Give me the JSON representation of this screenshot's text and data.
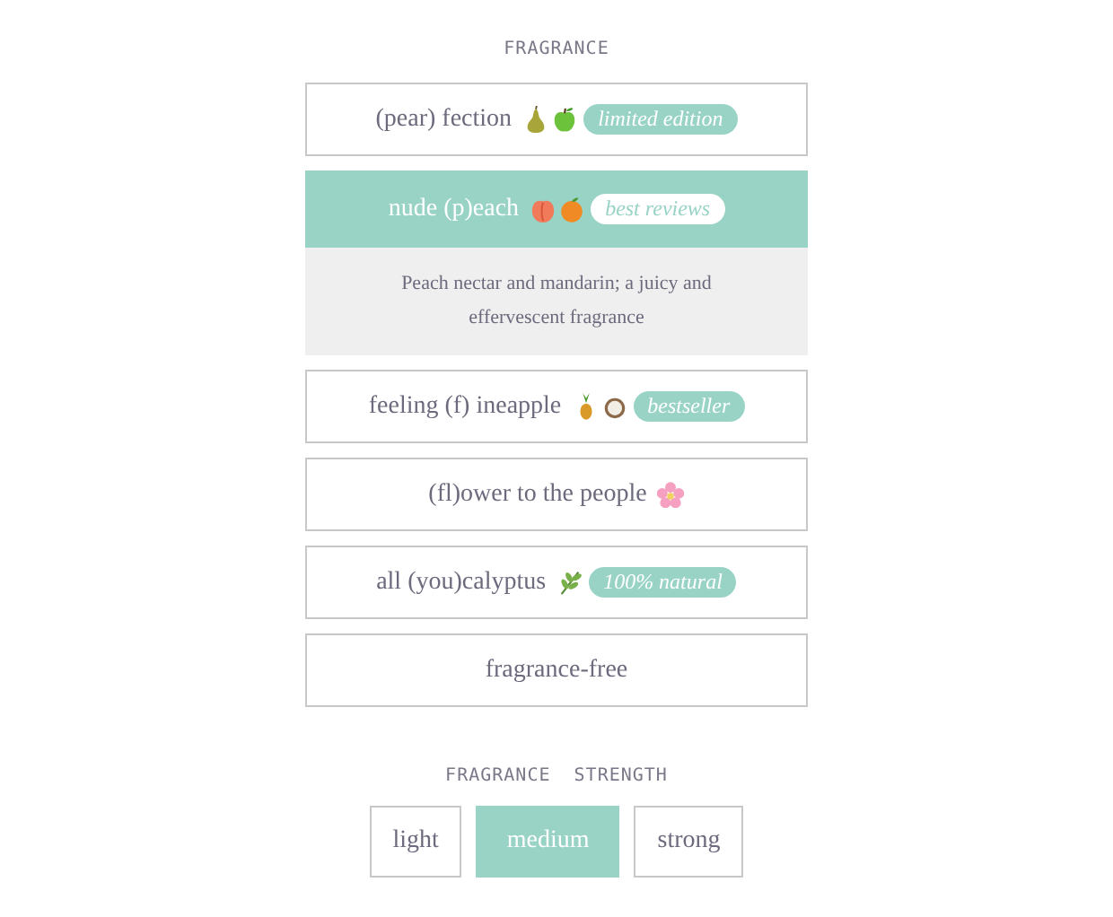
{
  "fragrance": {
    "title": "FRAGRANCE",
    "options": [
      {
        "label": "(pear) fection",
        "badge": "limited edition",
        "selected": false
      },
      {
        "label": "nude (p)each",
        "badge": "best reviews",
        "selected": true,
        "description": "Peach nectar and mandarin; a juicy and effervescent fragrance"
      },
      {
        "label": "feeling (f) ineapple",
        "badge": "bestseller",
        "selected": false
      },
      {
        "label": "(fl)ower to the people",
        "selected": false
      },
      {
        "label": "all (you)calyptus",
        "badge": "100% natural",
        "selected": false
      },
      {
        "label": "fragrance-free",
        "selected": false
      }
    ]
  },
  "strength": {
    "title": "FRAGRANCE  STRENGTH",
    "options": [
      {
        "label": "light",
        "selected": false
      },
      {
        "label": "medium",
        "selected": true
      },
      {
        "label": "strong",
        "selected": false
      }
    ]
  }
}
